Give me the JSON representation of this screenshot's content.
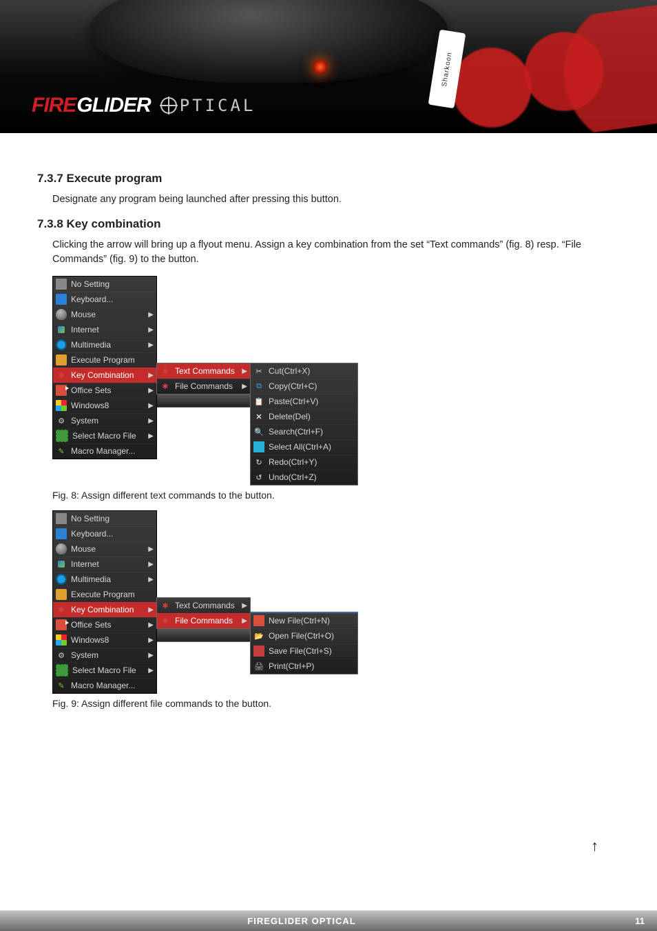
{
  "brand": {
    "fire": "FIRE",
    "glider": "GLIDER",
    "optical": "PTICAL",
    "badge": "Sharkoon"
  },
  "sections": {
    "s1_title": "7.3.7 Execute program",
    "s1_body": "Designate any program being launched after pressing this button.",
    "s2_title": "7.3.8 Key combination",
    "s2_body": "Clicking the arrow will bring up a flyout menu. Assign a key combination from the set “Text commands” (fig. 8) resp. “File Commands” (fig. 9) to the button."
  },
  "captions": {
    "fig8": "Fig. 8: Assign different text commands to the button.",
    "fig9": "Fig. 9: Assign different file commands to the button."
  },
  "menu_main": {
    "items": [
      {
        "label": "No Setting",
        "arrow": false
      },
      {
        "label": "Keyboard...",
        "arrow": false
      },
      {
        "label": "Mouse",
        "arrow": true
      },
      {
        "label": "Internet",
        "arrow": true
      },
      {
        "label": "Multimedia",
        "arrow": true
      },
      {
        "label": "Execute Program",
        "arrow": false
      },
      {
        "label": "Key Combination",
        "arrow": true,
        "hl": true
      },
      {
        "label": "Office Sets",
        "arrow": true
      },
      {
        "label": "Windows8",
        "arrow": true
      },
      {
        "label": "System",
        "arrow": true
      },
      {
        "label": "Select Macro File",
        "arrow": true
      },
      {
        "label": "Macro Manager...",
        "arrow": false
      }
    ]
  },
  "submenu_keycombo": {
    "items": [
      {
        "label": "Text Commands",
        "arrow": true
      },
      {
        "label": "File Commands",
        "arrow": true
      }
    ]
  },
  "text_commands": {
    "items": [
      {
        "label": "Cut(Ctrl+X)"
      },
      {
        "label": "Copy(Ctrl+C)"
      },
      {
        "label": "Paste(Ctrl+V)"
      },
      {
        "label": "Delete(Del)"
      },
      {
        "label": "Search(Ctrl+F)"
      },
      {
        "label": "Select All(Ctrl+A)"
      },
      {
        "label": "Redo(Ctrl+Y)"
      },
      {
        "label": "Undo(Ctrl+Z)"
      }
    ]
  },
  "file_commands": {
    "items": [
      {
        "label": "New File(Ctrl+N)"
      },
      {
        "label": "Open File(Ctrl+O)"
      },
      {
        "label": "Save File(Ctrl+S)"
      },
      {
        "label": "Print(Ctrl+P)"
      }
    ]
  },
  "slice_label": "",
  "footer": {
    "title": "FIREGLIDER OPTICAL",
    "page": "11"
  }
}
